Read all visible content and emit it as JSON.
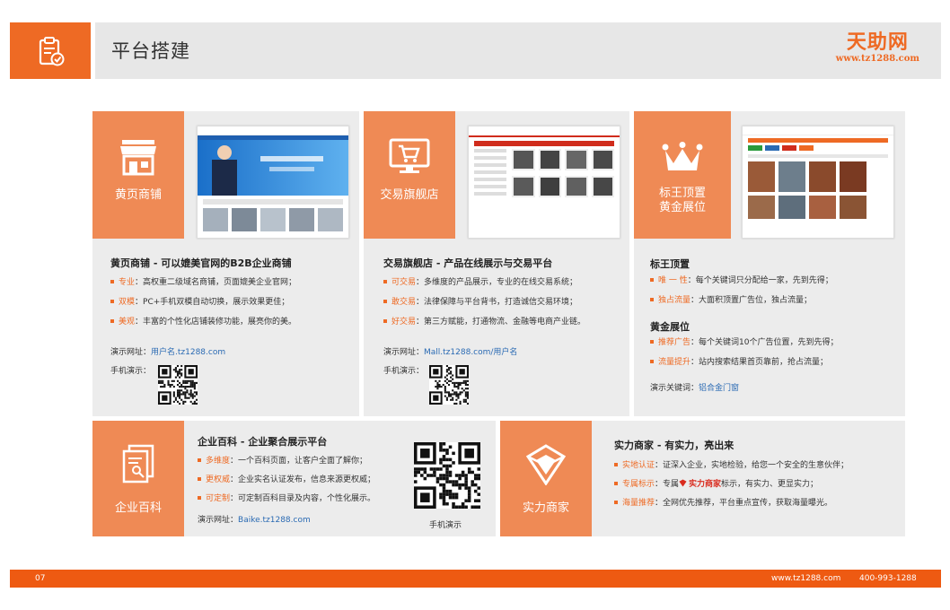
{
  "header": {
    "title": "平台搭建",
    "logo_text": "天助网",
    "logo_url": "www.tz1288.com"
  },
  "cards": {
    "yellow": {
      "tile": "黄页商铺",
      "heading": "黄页商铺 - 可以媲美官网的B2B企业商铺",
      "features": [
        {
          "key": "专业",
          "text": "：高权重二级域名商铺，页面媲美企业官网；"
        },
        {
          "key": "双模",
          "text": "：PC+手机双模自动切换，展示效果更佳；"
        },
        {
          "key": "美观",
          "text": "：丰富的个性化店铺装修功能，展亮你的美。"
        }
      ],
      "demo_label": "演示网址：",
      "demo_link": "用户名.tz1288.com",
      "mobile_label": "手机演示："
    },
    "trade": {
      "tile": "交易旗舰店",
      "heading": "交易旗舰店 - 产品在线展示与交易平台",
      "features": [
        {
          "key": "可交易",
          "text": "：多维度的产品展示，专业的在线交易系统；"
        },
        {
          "key": "敢交易",
          "text": "：法律保障与平台背书，打造诚信交易环境；"
        },
        {
          "key": "好交易",
          "text": "：第三方赋能，打通物流、金融等电商产业链。"
        }
      ],
      "demo_label": "演示网址：",
      "demo_link": "Mall.tz1288.com/用户名",
      "mobile_label": "手机演示："
    },
    "crown": {
      "tile_line1": "标王顶置",
      "tile_line2": "黄金展位",
      "heading1": "标王顶置",
      "features1": [
        {
          "key": "唯 一 性",
          "text": "：每个关键词只分配给一家，先到先得；"
        },
        {
          "key": "独占流量",
          "text": "：大面积顶置广告位，独占流量；"
        }
      ],
      "heading2": "黄金展位",
      "features2": [
        {
          "key": "推荐广告",
          "text": "：每个关键词10个广告位置，先到先得；"
        },
        {
          "key": "流量提升",
          "text": "：站内搜索结果首页靠前，抢占流量；"
        }
      ],
      "demo_label": "演示关键词：",
      "demo_link": "铝合金门窗"
    },
    "baike": {
      "tile": "企业百科",
      "heading": "企业百科 - 企业聚合展示平台",
      "features": [
        {
          "key": "多维度",
          "text": "：一个百科页面，让客户全面了解你；"
        },
        {
          "key": "更权威",
          "text": "：企业实名认证发布，信息来源更权威；"
        },
        {
          "key": "可定制",
          "text": "：可定制百科目录及内容，个性化展示。"
        }
      ],
      "demo_label": "演示网址：",
      "demo_link": "Baike.tz1288.com",
      "qr_caption": "手机演示"
    },
    "strength": {
      "tile": "实力商家",
      "heading": "实力商家 - 有实力，亮出来",
      "features": [
        {
          "key": "实地认证",
          "text": "：证深入企业，实地检验，给您一个安全的生意伙伴；"
        },
        {
          "key": "专属标示",
          "pre": "：专属 ",
          "badge": "实力商家",
          "text": " 标示，有实力、更显实力；"
        },
        {
          "key": "海量推荐",
          "text": "：全网优先推荐，平台重点宣传，获取海量曝光。"
        }
      ]
    }
  },
  "footer": {
    "page": "07",
    "site": "www.tz1288.com",
    "phone": "400-993-1288"
  },
  "colors": {
    "accent": "#ee6a24",
    "tile": "#ef8a55",
    "card": "#ececec",
    "link": "#2a6ab3"
  }
}
